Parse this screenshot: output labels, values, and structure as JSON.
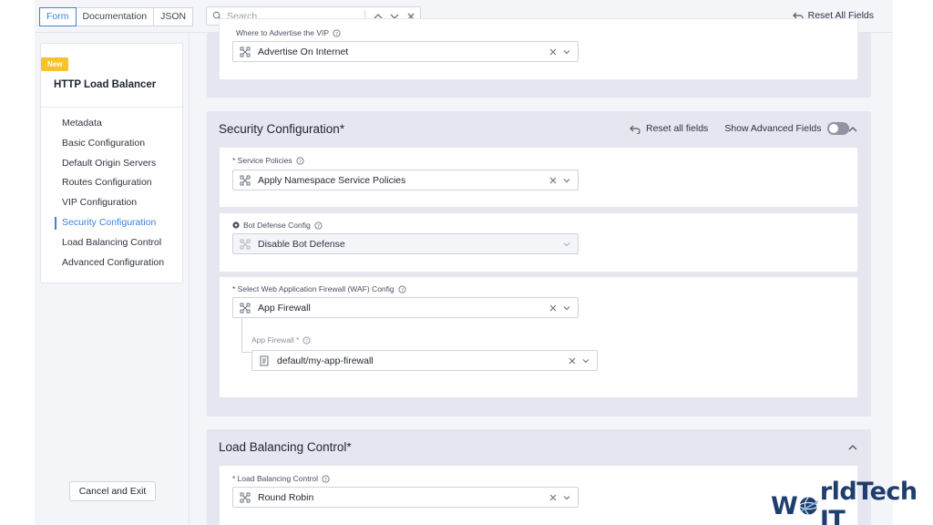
{
  "tabs": [
    {
      "label": "Form",
      "active": true
    },
    {
      "label": "Documentation",
      "active": false
    },
    {
      "label": "JSON",
      "active": false
    }
  ],
  "search": {
    "placeholder": "Search"
  },
  "toolbar": {
    "reset_all_fields": "Reset All Fields"
  },
  "sidebar": {
    "badge": "New",
    "title": "HTTP Load Balancer",
    "items": [
      {
        "label": "Metadata"
      },
      {
        "label": "Basic Configuration"
      },
      {
        "label": "Default Origin Servers"
      },
      {
        "label": "Routes Configuration"
      },
      {
        "label": "VIP Configuration"
      },
      {
        "label": "Security Configuration",
        "active": true
      },
      {
        "label": "Load Balancing Control"
      },
      {
        "label": "Advanced Configuration"
      }
    ],
    "cancel_label": "Cancel and Exit"
  },
  "vip": {
    "field_label": "Where to Advertise the VIP",
    "value": "Advertise On Internet"
  },
  "security": {
    "title": "Security Configuration",
    "required_mark": "*",
    "reset_label": "Reset all fields",
    "advanced_label": "Show Advanced Fields",
    "service_policies": {
      "label": "* Service Policies",
      "value": "Apply Namespace Service Policies"
    },
    "bot_defense": {
      "label": "Bot Defense Config",
      "value": "Disable Bot Defense"
    },
    "waf": {
      "label": "* Select Web Application Firewall (WAF) Config",
      "value": "App Firewall"
    },
    "app_firewall": {
      "label": "App Firewall *",
      "value": "default/my-app-firewall"
    }
  },
  "load_balancing": {
    "title": "Load Balancing Control",
    "required_mark": "*",
    "field_label": "* Load Balancing Control",
    "value": "Round Robin"
  },
  "watermark": {
    "left": "W",
    "right": "rldTech IT"
  },
  "colors": {
    "accent": "#3b82e0",
    "badge": "#f8c12d",
    "section_bg": "#e5e6f0"
  }
}
